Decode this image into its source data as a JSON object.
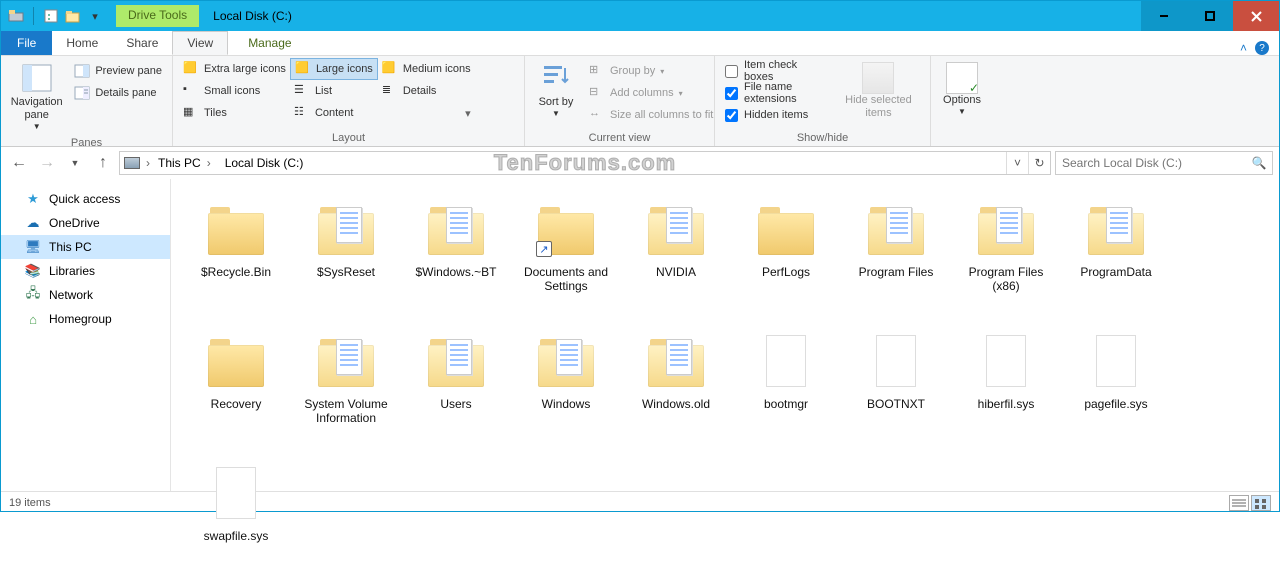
{
  "title": "Local Disk (C:)",
  "contextTab": "Drive Tools",
  "tabs": {
    "file": "File",
    "home": "Home",
    "share": "Share",
    "view": "View",
    "manage": "Manage"
  },
  "ribbon": {
    "panes": {
      "title": "Panes",
      "nav": "Navigation pane",
      "preview": "Preview pane",
      "details": "Details pane"
    },
    "layout": {
      "title": "Layout",
      "xl": "Extra large icons",
      "lg": "Large icons",
      "md": "Medium icons",
      "sm": "Small icons",
      "list": "List",
      "det": "Details",
      "tiles": "Tiles",
      "content": "Content"
    },
    "currentview": {
      "title": "Current view",
      "sort": "Sort by",
      "group": "Group by",
      "add": "Add columns",
      "size": "Size all columns to fit"
    },
    "showhide": {
      "title": "Show/hide",
      "checkboxes": "Item check boxes",
      "ext": "File name extensions",
      "hidden": "Hidden items",
      "hidesel": "Hide selected items"
    },
    "options": "Options"
  },
  "breadcrumb": [
    "This PC",
    "Local Disk (C:)"
  ],
  "searchPlaceholder": "Search Local Disk (C:)",
  "watermark": "TenForums.com",
  "sidebar": [
    {
      "label": "Quick access",
      "icon": "star",
      "color": "#2e9bd6"
    },
    {
      "label": "OneDrive",
      "icon": "cloud",
      "color": "#1a6fb1"
    },
    {
      "label": "This PC",
      "icon": "pc",
      "color": "#2e7abf",
      "selected": true
    },
    {
      "label": "Libraries",
      "icon": "lib",
      "color": "#4aa8a0"
    },
    {
      "label": "Network",
      "icon": "net",
      "color": "#3a7c58"
    },
    {
      "label": "Homegroup",
      "icon": "home",
      "color": "#4aa050"
    }
  ],
  "items": [
    {
      "name": "$Recycle.Bin",
      "type": "folder"
    },
    {
      "name": "$SysReset",
      "type": "folder-open"
    },
    {
      "name": "$Windows.~BT",
      "type": "folder-open"
    },
    {
      "name": "Documents and Settings",
      "type": "folder",
      "shortcut": true
    },
    {
      "name": "NVIDIA",
      "type": "folder-open"
    },
    {
      "name": "PerfLogs",
      "type": "folder"
    },
    {
      "name": "Program Files",
      "type": "folder-open"
    },
    {
      "name": "Program Files (x86)",
      "type": "folder-open"
    },
    {
      "name": "ProgramData",
      "type": "folder-open"
    },
    {
      "name": "Recovery",
      "type": "folder"
    },
    {
      "name": "System Volume Information",
      "type": "folder-open"
    },
    {
      "name": "Users",
      "type": "folder-open"
    },
    {
      "name": "Windows",
      "type": "folder-open"
    },
    {
      "name": "Windows.old",
      "type": "folder-open"
    },
    {
      "name": "bootmgr",
      "type": "sys"
    },
    {
      "name": "BOOTNXT",
      "type": "sys"
    },
    {
      "name": "hiberfil.sys",
      "type": "sys"
    },
    {
      "name": "pagefile.sys",
      "type": "sys"
    },
    {
      "name": "swapfile.sys",
      "type": "sys"
    }
  ],
  "status": {
    "count": "19 items"
  },
  "checkboxes": {
    "checkboxes": false,
    "ext": true,
    "hidden": true
  }
}
